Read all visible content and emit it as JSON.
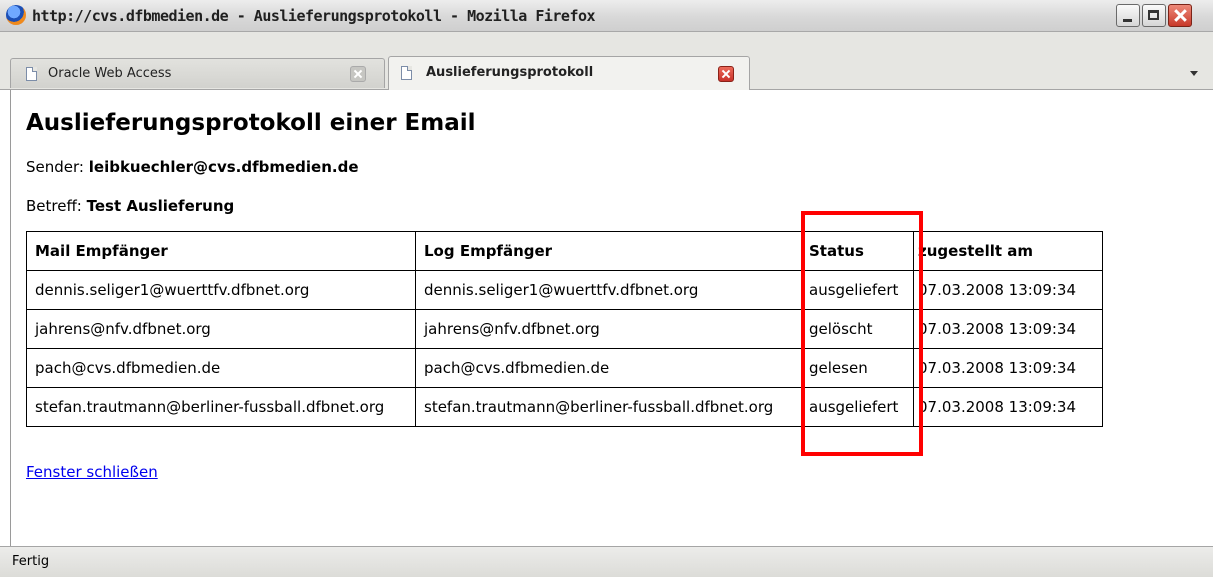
{
  "window": {
    "title": "http://cvs.dfbmedien.de - Auslieferungsprotokoll - Mozilla Firefox"
  },
  "tabs": [
    {
      "label": "Oracle Web Access",
      "active": false
    },
    {
      "label": "Auslieferungsprotokoll",
      "active": true
    }
  ],
  "page": {
    "title": "Auslieferungsprotokoll einer Email",
    "sender_label": "Sender:",
    "sender_value": "leibkuechler@cvs.dfbmedien.de",
    "subject_label": "Betreff:",
    "subject_value": "Test Auslieferung",
    "close_link": "Fenster schließen"
  },
  "table": {
    "headers": [
      "Mail Empfänger",
      "Log Empfänger",
      "Status",
      "zugestellt am"
    ],
    "rows": [
      [
        "dennis.seliger1@wuerttfv.dfbnet.org",
        "dennis.seliger1@wuerttfv.dfbnet.org",
        "ausgeliefert",
        "07.03.2008 13:09:34"
      ],
      [
        "jahrens@nfv.dfbnet.org",
        "jahrens@nfv.dfbnet.org",
        "gelöscht",
        "07.03.2008 13:09:34"
      ],
      [
        "pach@cvs.dfbmedien.de",
        "pach@cvs.dfbmedien.de",
        "gelesen",
        "07.03.2008 13:09:34"
      ],
      [
        "stefan.trautmann@berliner-fussball.dfbnet.org",
        "stefan.trautmann@berliner-fussball.dfbnet.org",
        "ausgeliefert",
        "07.03.2008 13:09:34"
      ]
    ]
  },
  "statusbar": {
    "text": "Fertig"
  },
  "colors": {
    "highlight": "#ff0000",
    "link": "#0000ee"
  }
}
